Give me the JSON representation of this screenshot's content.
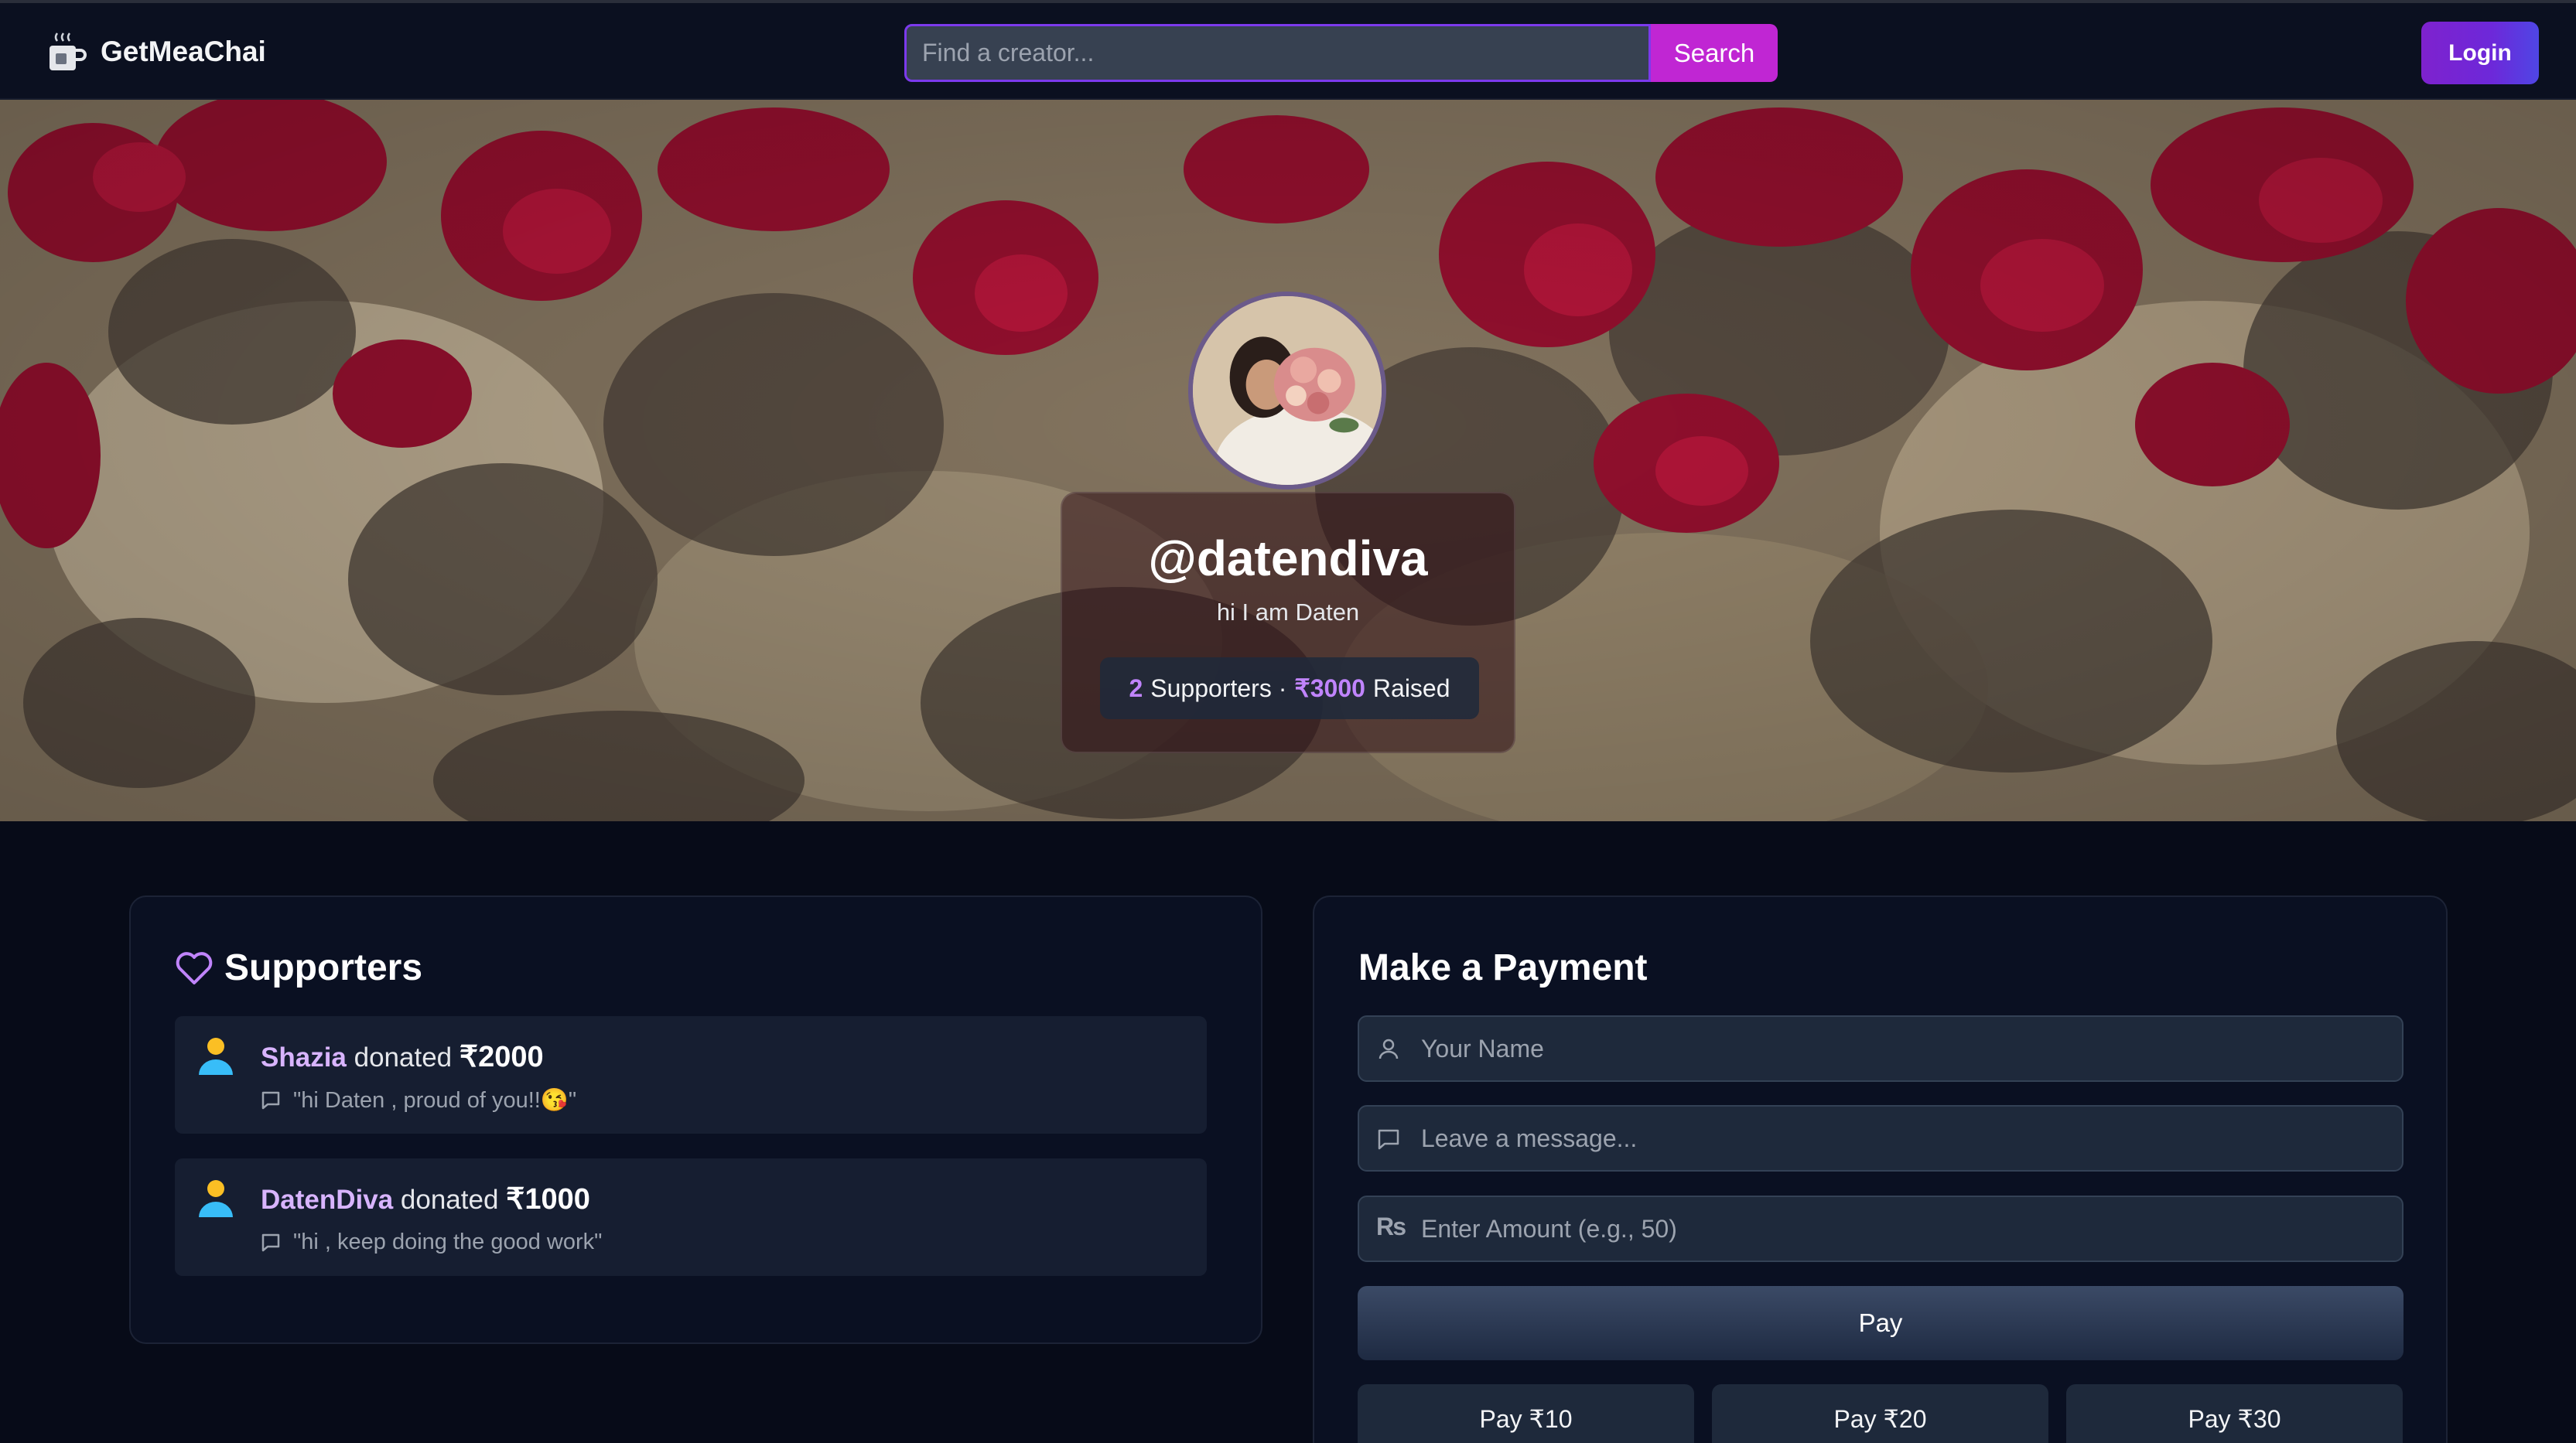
{
  "navbar": {
    "brand": "GetMeaChai",
    "search_placeholder": "Find a creator...",
    "search_label": "Search",
    "login_label": "Login"
  },
  "profile": {
    "handle": "@datendiva",
    "bio": "hi I am Daten",
    "supporters_count": "2",
    "supporters_label": "Supporters ·",
    "raised_amount": "₹3000",
    "raised_label": "Raised"
  },
  "supporters": {
    "title": "Supporters",
    "items": [
      {
        "name": "Shazia",
        "verb": "donated",
        "amount": "₹2000",
        "message": "\"hi Daten , proud of you!!😘\""
      },
      {
        "name": "DatenDiva",
        "verb": "donated",
        "amount": "₹1000",
        "message": "\"hi , keep doing the good work\""
      }
    ]
  },
  "payment": {
    "title": "Make a Payment",
    "name_placeholder": "Your Name",
    "message_placeholder": "Leave a message...",
    "amount_placeholder": "Enter Amount (e.g., 50)",
    "pay_label": "Pay",
    "quick_amounts": [
      "Pay ₹10",
      "Pay ₹20",
      "Pay ₹30"
    ]
  },
  "colors": {
    "accent_purple": "#7c3aed",
    "search_button": "#c026d3",
    "highlight_text": "#c084fc",
    "supporter_name": "#d8b4fe"
  }
}
